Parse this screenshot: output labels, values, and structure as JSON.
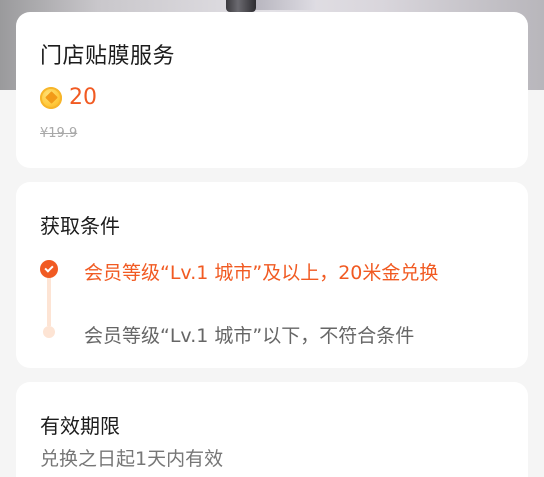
{
  "product": {
    "title": "门店贴膜服务",
    "price": "20",
    "original_price": "¥19.9",
    "coin_icon": "gold-coin-icon"
  },
  "conditions": {
    "title": "获取条件",
    "items": [
      {
        "text": "会员等级“Lv.1 城市”及以上，20米金兑换",
        "state": "met"
      },
      {
        "text": "会员等级“Lv.1 城市”以下，不符合条件",
        "state": "unmet"
      }
    ]
  },
  "validity": {
    "title": "有效期限",
    "text": "兑换之日起1天内有效"
  },
  "colors": {
    "accent": "#f15a22",
    "accent_light": "#fde4d4",
    "background": "#f5f5f5",
    "card": "#ffffff"
  }
}
